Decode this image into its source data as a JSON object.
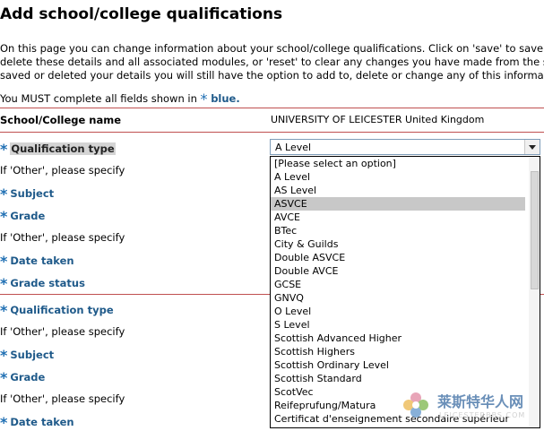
{
  "page": {
    "title": "Add school/college qualifications",
    "intro_lines": [
      "On this page you can change information about your school/college qualifications. Click on 'save' to save your",
      "delete these details and all associated modules, or 'reset' to clear any changes you have made from the sc",
      "saved or deleted your details you will still have the option to add to, delete or change any of this informatio"
    ],
    "required_note_prefix": "You MUST complete all fields shown in",
    "required_note_blue": "blue."
  },
  "school": {
    "label": "School/College name",
    "value": "UNIVERSITY OF LEICESTER United Kingdom"
  },
  "asterisk": "*",
  "form1": {
    "qualification_type_label": "Qualification type",
    "other_label_1": "If 'Other', please specify",
    "subject_label": "Subject",
    "grade_label": "Grade",
    "other_label_2": "If 'Other', please specify",
    "date_taken_label": "Date taken",
    "grade_status_label": "Grade status"
  },
  "form2": {
    "qualification_type_label": "Qualification type",
    "other_label_1": "If 'Other', please specify",
    "subject_label": "Subject",
    "grade_label": "Grade",
    "other_label_2": "If 'Other', please specify",
    "date_taken_label": "Date taken"
  },
  "select": {
    "current_value": "A Level",
    "highlighted_option": "ASVCE",
    "options": [
      "[Please select an option]",
      "A Level",
      "AS Level",
      "ASVCE",
      "AVCE",
      "BTec",
      "City & Guilds",
      "Double ASVCE",
      "Double AVCE",
      "GCSE",
      "GNVQ",
      "O Level",
      "S Level",
      "Scottish Advanced Higher",
      "Scottish Highers",
      "Scottish Ordinary Level",
      "Scottish Standard",
      "ScotVec",
      "Reifeprufung/Matura",
      "Certificat d'enseignement secondaire supérieur"
    ]
  },
  "watermark": {
    "cn_text": "莱斯特华人网",
    "url_text": "LEICESTERBBS.COM"
  },
  "colors": {
    "required_blue": "#1f5a8a",
    "asterisk_blue": "#1f6fb3",
    "divider_red": "#c05050",
    "selected_gray": "#c8c8c8"
  }
}
